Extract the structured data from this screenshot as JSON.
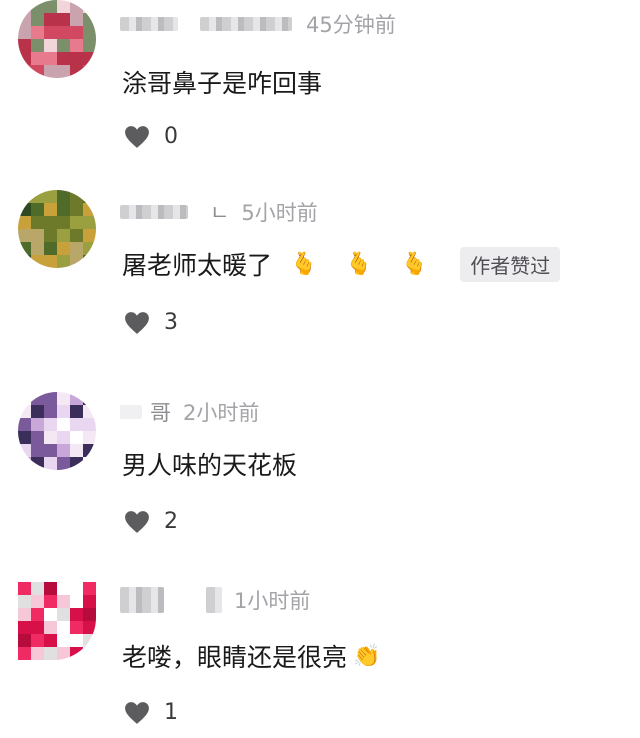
{
  "comments": [
    {
      "time": "45分钟前",
      "text": "涂哥鼻子是咋回事",
      "likes": "0",
      "avatar_colors": [
        "#b8324a",
        "#d24860",
        "#e87a8e",
        "#7a8f6a",
        "#c9a3ad",
        "#f2d5db"
      ]
    },
    {
      "nick": "ㄴ",
      "time": "5小时前",
      "text": "屠老师太暖了",
      "emojis": [
        "🫰",
        "🫰",
        "🫰"
      ],
      "badge": "作者赞过",
      "likes": "3",
      "avatar_colors": [
        "#6d7a2a",
        "#9aa040",
        "#c8a13a",
        "#4f6b2a",
        "#b9a76a",
        "#2f4a20"
      ]
    },
    {
      "nick": "哥",
      "time": "2小时前",
      "text": "男人味的天花板",
      "likes": "2",
      "avatar_colors": [
        "#e9d6f0",
        "#f5e8f5",
        "#3b2e5a",
        "#c9a7d8",
        "#ffffff",
        "#7a5a9a"
      ]
    },
    {
      "time": "1小时前",
      "text": "老喽，眼睛还是很亮",
      "emojis": [
        "👏"
      ],
      "likes": "1",
      "avatar_colors": [
        "#d8104a",
        "#f02a62",
        "#f6c7d6",
        "#e0e0e0",
        "#b50c3d",
        "#ffffff"
      ]
    }
  ]
}
